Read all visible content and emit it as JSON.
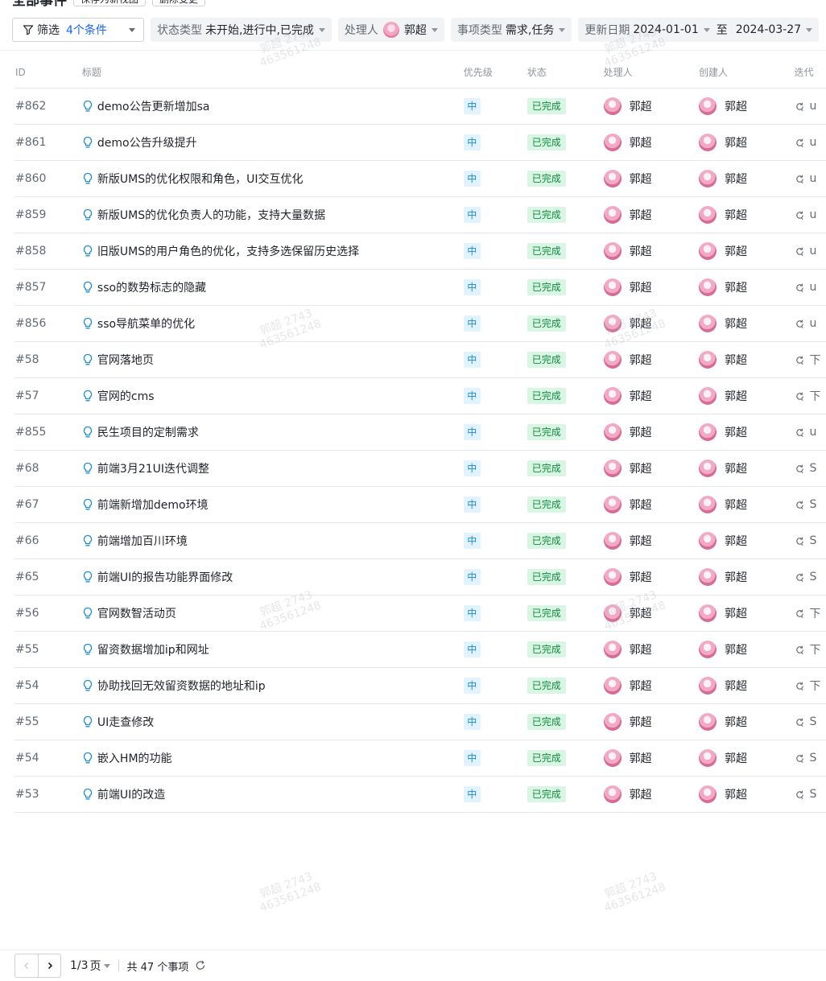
{
  "top_partial": {
    "title": "全部事件",
    "chips": [
      "保存为新视图",
      "删除变更"
    ]
  },
  "filter": {
    "main_label": "筛选",
    "count_label": "4个条件",
    "chips": [
      {
        "key": "状态类型",
        "value": "未开始,进行中,已完成"
      },
      {
        "key": "处理人",
        "value": "郭超"
      },
      {
        "key": "事项类型",
        "value": "需求,任务"
      }
    ],
    "date": {
      "key": "更新日期",
      "from": "2024-01-01",
      "sep": "至",
      "to": "2024-03-27"
    }
  },
  "columns": [
    "ID",
    "标题",
    "优先级",
    "状态",
    "处理人",
    "创建人",
    "迭代"
  ],
  "rows": [
    {
      "id": "#862",
      "title": "demo公告更新增加sa",
      "priority": "中",
      "status": "已完成",
      "assignee": "郭超",
      "creator": "郭超",
      "iteration": "u"
    },
    {
      "id": "#861",
      "title": "demo公告升级提升",
      "priority": "中",
      "status": "已完成",
      "assignee": "郭超",
      "creator": "郭超",
      "iteration": "u"
    },
    {
      "id": "#860",
      "title": "新版UMS的优化权限和角色，UI交互优化",
      "priority": "中",
      "status": "已完成",
      "assignee": "郭超",
      "creator": "郭超",
      "iteration": "u"
    },
    {
      "id": "#859",
      "title": "新版UMS的优化负责人的功能，支持大量数据",
      "priority": "中",
      "status": "已完成",
      "assignee": "郭超",
      "creator": "郭超",
      "iteration": "u"
    },
    {
      "id": "#858",
      "title": "旧版UMS的用户角色的优化，支持多选保留历史选择",
      "priority": "中",
      "status": "已完成",
      "assignee": "郭超",
      "creator": "郭超",
      "iteration": "u"
    },
    {
      "id": "#857",
      "title": "sso的数势标志的隐藏",
      "priority": "中",
      "status": "已完成",
      "assignee": "郭超",
      "creator": "郭超",
      "iteration": "u"
    },
    {
      "id": "#856",
      "title": "sso导航菜单的优化",
      "priority": "中",
      "status": "已完成",
      "assignee": "郭超",
      "creator": "郭超",
      "iteration": "u"
    },
    {
      "id": "#58",
      "title": "官网落地页",
      "priority": "中",
      "status": "已完成",
      "assignee": "郭超",
      "creator": "郭超",
      "iteration": "下"
    },
    {
      "id": "#57",
      "title": "官网的cms",
      "priority": "中",
      "status": "已完成",
      "assignee": "郭超",
      "creator": "郭超",
      "iteration": "下"
    },
    {
      "id": "#855",
      "title": "民生项目的定制需求",
      "priority": "中",
      "status": "已完成",
      "assignee": "郭超",
      "creator": "郭超",
      "iteration": "u"
    },
    {
      "id": "#68",
      "title": "前端3月21UI迭代调整",
      "priority": "中",
      "status": "已完成",
      "assignee": "郭超",
      "creator": "郭超",
      "iteration": "S"
    },
    {
      "id": "#67",
      "title": "前端新增加demo环境",
      "priority": "中",
      "status": "已完成",
      "assignee": "郭超",
      "creator": "郭超",
      "iteration": "S"
    },
    {
      "id": "#66",
      "title": "前端增加百川环境",
      "priority": "中",
      "status": "已完成",
      "assignee": "郭超",
      "creator": "郭超",
      "iteration": "S"
    },
    {
      "id": "#65",
      "title": "前端UI的报告功能界面修改",
      "priority": "中",
      "status": "已完成",
      "assignee": "郭超",
      "creator": "郭超",
      "iteration": "S"
    },
    {
      "id": "#56",
      "title": "官网数智活动页",
      "priority": "中",
      "status": "已完成",
      "assignee": "郭超",
      "creator": "郭超",
      "iteration": "下"
    },
    {
      "id": "#55",
      "title": "留资数据增加ip和网址",
      "priority": "中",
      "status": "已完成",
      "assignee": "郭超",
      "creator": "郭超",
      "iteration": "下"
    },
    {
      "id": "#54",
      "title": "协助找回无效留资数据的地址和ip",
      "priority": "中",
      "status": "已完成",
      "assignee": "郭超",
      "creator": "郭超",
      "iteration": "下"
    },
    {
      "id": "#55",
      "title": "UI走查修改",
      "priority": "中",
      "status": "已完成",
      "assignee": "郭超",
      "creator": "郭超",
      "iteration": "S"
    },
    {
      "id": "#54",
      "title": "嵌入HM的功能",
      "priority": "中",
      "status": "已完成",
      "assignee": "郭超",
      "creator": "郭超",
      "iteration": "S"
    },
    {
      "id": "#53",
      "title": "前端UI的改造",
      "priority": "中",
      "status": "已完成",
      "assignee": "郭超",
      "creator": "郭超",
      "iteration": "S"
    }
  ],
  "pager": {
    "page": "1/3",
    "page_suffix": "页",
    "total": "共 47 个事项"
  },
  "watermark": {
    "line1": "郭超 2743",
    "line2": "463561248"
  },
  "colors": {
    "accent": "#1664ff",
    "priority_bg": "#e1f3fe",
    "priority_text": "#1e8ad8",
    "done_bg": "#d9f5e3",
    "done_text": "#118a3f"
  }
}
